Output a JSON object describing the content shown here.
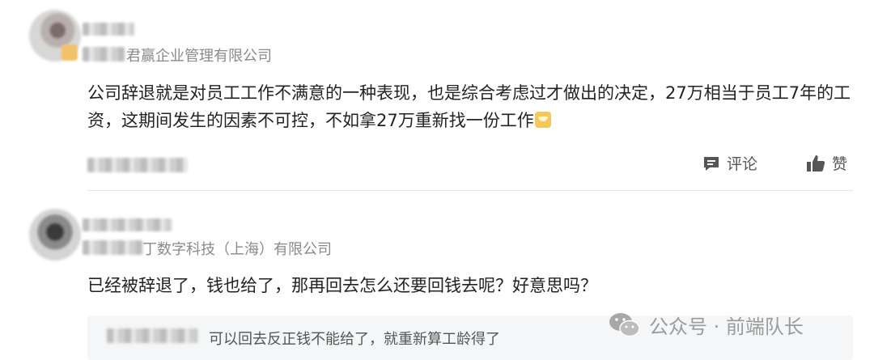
{
  "comments": [
    {
      "company": "君赢企业管理有限公司",
      "text": "公司辞退就是对员工工作不满意的一种表现，也是综合考虑过才做出的决定，27万相当于员工7年的工资，这期间发生的因素不可控，不如拿27万重新找一份工作",
      "actions": {
        "comment_label": "评论",
        "like_label": "赞"
      }
    },
    {
      "company": "丁数字科技（上海）有限公司",
      "text": "已经被辞退了，钱也给了，那再回去怎么还要回钱去呢？好意思吗？",
      "reply": {
        "text": "可以回去反正钱不能给了，就重新算工龄得了"
      }
    }
  ],
  "watermark": {
    "text": "公众号 · 前端队长"
  },
  "icons": [
    "comment-icon",
    "thumbs-up-icon",
    "wechat-icon",
    "emoji-icon"
  ],
  "colors": {
    "text": "#222222",
    "muted": "#8a8a8a",
    "reply_bg": "#f5f6f7"
  }
}
